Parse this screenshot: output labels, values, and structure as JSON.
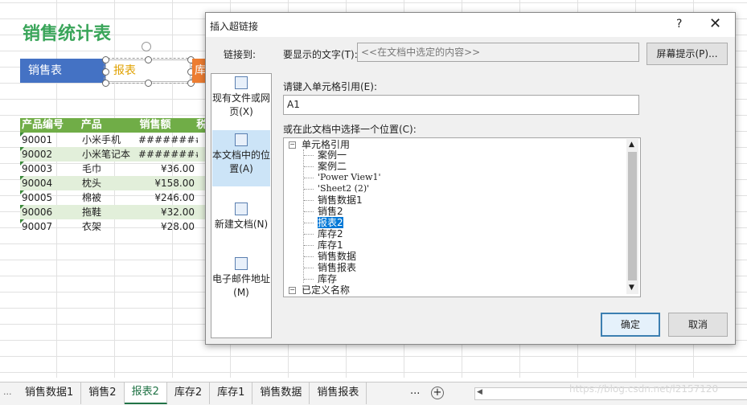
{
  "sheet": {
    "title": "销售统计表",
    "shapes": {
      "blue": "销售表",
      "selected": "报表",
      "orange": "库"
    },
    "table": {
      "headers": [
        "产品编号",
        "产品",
        "销售额",
        "税"
      ],
      "rows": [
        [
          "90001",
          "小米手机",
          "########"
        ],
        [
          "90002",
          "小米笔记本",
          "########"
        ],
        [
          "90003",
          "毛巾",
          "¥36.00"
        ],
        [
          "90004",
          "枕头",
          "¥158.00"
        ],
        [
          "90005",
          "棉被",
          "¥246.00"
        ],
        [
          "90006",
          "拖鞋",
          "¥32.00"
        ],
        [
          "90007",
          "衣架",
          "¥28.00"
        ]
      ]
    }
  },
  "dialog": {
    "title": "插入超链接",
    "help": "?",
    "close": "✕",
    "link_to_label": "链接到:",
    "link_items": [
      {
        "label": "现有文件或网页(X)",
        "icon": "document-web-icon"
      },
      {
        "label": "本文档中的位置(A)",
        "icon": "document-place-icon"
      },
      {
        "label": "新建文档(N)",
        "icon": "new-document-icon"
      },
      {
        "label": "电子邮件地址(M)",
        "icon": "email-icon"
      }
    ],
    "display_text_label": "要显示的文字(T):",
    "display_text_value": "<<在文档中选定的内容>>",
    "screen_tip_button": "屏幕提示(P)...",
    "cell_ref_label": "请键入单元格引用(E):",
    "cell_ref_value": "A1",
    "location_label": "或在此文档中选择一个位置(C):",
    "tree": {
      "group1": "单元格引用",
      "items": [
        "案例一",
        "案例二",
        "'Power View1'",
        "'Sheet2 (2)'",
        "销售数据1",
        "销售2",
        "报表2",
        "库存2",
        "库存1",
        "销售数据",
        "销售报表",
        "库存"
      ],
      "selected_index": 6,
      "group2": "已定义名称",
      "scroll_up": "▲",
      "scroll_down": "▼"
    },
    "ok_button": "确定",
    "cancel_button": "取消"
  },
  "tabs": {
    "items": [
      "...",
      "销售数据1",
      "销售2",
      "报表2",
      "库存2",
      "库存1",
      "销售数据",
      "销售报表"
    ],
    "active_index": 3,
    "more": "...",
    "add": "+",
    "scroll_left": "◀"
  },
  "watermark": "https://blog.csdn.net/l2157120"
}
